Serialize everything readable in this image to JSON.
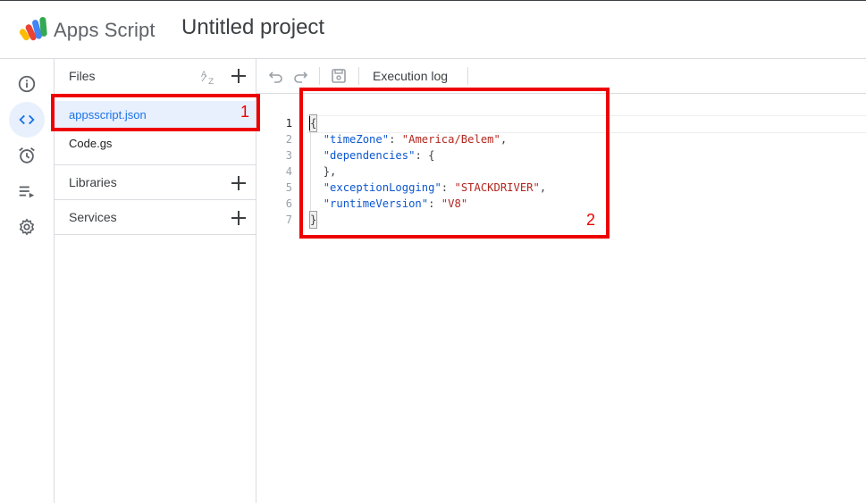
{
  "header": {
    "app_name": "Apps Script",
    "project_title": "Untitled project"
  },
  "rail": {
    "items": [
      {
        "icon": "info-icon",
        "active": false
      },
      {
        "icon": "code-icon",
        "active": true
      },
      {
        "icon": "alarm-clock-icon",
        "active": false
      },
      {
        "icon": "executions-icon",
        "active": false
      },
      {
        "icon": "gear-icon",
        "active": false
      }
    ]
  },
  "files_panel": {
    "title": "Files",
    "files": [
      {
        "name": "appsscript.json",
        "selected": true
      },
      {
        "name": "Code.gs",
        "selected": false
      }
    ],
    "sections": [
      {
        "label": "Libraries"
      },
      {
        "label": "Services"
      }
    ]
  },
  "toolbar": {
    "execution_log_label": "Execution log"
  },
  "editor": {
    "line_numbers": [
      "1",
      "2",
      "3",
      "4",
      "5",
      "6",
      "7"
    ],
    "lines": {
      "l1": "{",
      "l2_key": "timeZone",
      "l2_val": "America/Belem",
      "l3_key": "dependencies",
      "l3_rest": ": {",
      "l4": "},",
      "l5_key": "exceptionLogging",
      "l5_val": "STACKDRIVER",
      "l6_key": "runtimeVersion",
      "l6_val": "V8",
      "l7": "}"
    }
  },
  "annotations": [
    {
      "number": "1"
    },
    {
      "number": "2"
    }
  ],
  "colors": {
    "accent": "#1a73e8",
    "selected_bg": "#e8f0fe",
    "annotation_red": "#ee0000"
  }
}
